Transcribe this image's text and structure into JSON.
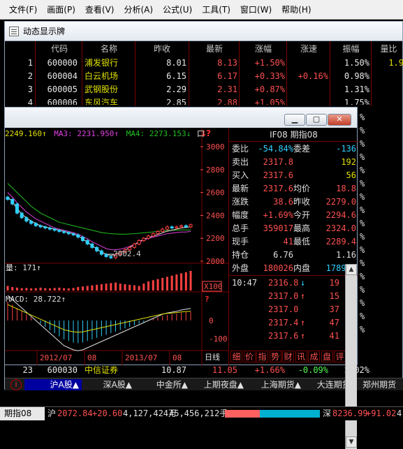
{
  "menu": [
    "文件(F)",
    "画面(P)",
    "查看(V)",
    "分析(A)",
    "公式(U)",
    "工具(T)",
    "窗口(W)",
    "帮助(H)"
  ],
  "subwindow_title": "动态显示牌",
  "table": {
    "headers": [
      "代码",
      "名称",
      "昨收",
      "最新",
      "涨幅",
      "涨速",
      "振幅",
      "量比"
    ],
    "rows": [
      {
        "idx": "1",
        "code": "600000",
        "name": "浦发银行",
        "prev": "8.01",
        "last": "8.13",
        "chg": "+1.50%",
        "speed": "",
        "amp": "1.50%",
        "vr": "1.9"
      },
      {
        "idx": "2",
        "code": "600004",
        "name": "白云机场",
        "prev": "6.15",
        "last": "6.17",
        "chg": "+0.33%",
        "speed": "+0.16%",
        "amp": "0.98%",
        "vr": ""
      },
      {
        "idx": "3",
        "code": "600005",
        "name": "武钢股份",
        "prev": "2.29",
        "last": "2.31",
        "chg": "+0.87%",
        "speed": "",
        "amp": "1.31%",
        "vr": ""
      },
      {
        "idx": "4",
        "code": "600006",
        "name": "东风汽车",
        "prev": "2.85",
        "last": "2.88",
        "chg": "+1.05%",
        "speed": "",
        "amp": "1.75%",
        "vr": ""
      }
    ],
    "row23": {
      "idx": "23",
      "code": "600030",
      "name": "中信证券",
      "prev": "10.87",
      "last": "11.05",
      "chg": "+1.66%",
      "speed": "-0.09%",
      "amp": "2.02%"
    },
    "partial_column": [
      "%",
      "%",
      "%",
      "%",
      "%",
      "%",
      "%",
      "%",
      "%",
      "%",
      "%",
      "%",
      "%",
      "%",
      "%",
      "%",
      "%"
    ]
  },
  "tabs": [
    {
      "label": "沪A股▲",
      "active": true
    },
    {
      "label": "深A股▲",
      "active": false
    },
    {
      "label": "中金所▲",
      "active": false
    },
    {
      "label": "上期夜盘▲",
      "active": false
    },
    {
      "label": "上海期货▲",
      "active": false
    },
    {
      "label": "大连期货▲",
      "active": false
    },
    {
      "label": "郑州期货",
      "active": false
    }
  ],
  "chart_window": {
    "title": "IF08 期指08",
    "legend": {
      "ma_prefix": "2249.160↑",
      "ma3": "MA3: 2231.950↑",
      "ma4": "MA4: 2273.153↓",
      "tail": "口"
    },
    "price_axis": [
      "3000",
      "2800",
      "2600",
      "2400",
      "2200",
      "2000"
    ],
    "low_label": "2002.4",
    "volume_label": "量: 171↑",
    "volume_unit": "X100",
    "macd_label": "MACD: 28.722↑",
    "macd_axis": [
      "0",
      "-100"
    ],
    "question_mark": "?",
    "date_labels": [
      "2012/07",
      "08",
      "2013/07",
      "08"
    ],
    "period": "日线",
    "icons_row": [
      "↓",
      "?"
    ]
  },
  "info_panel": {
    "rows": [
      {
        "l1": "委比",
        "v1": "-54.84%",
        "l2": "委差",
        "v2": "-136"
      },
      {
        "l1": "卖出",
        "v1": "2317.8",
        "l2": "",
        "v2": "192"
      },
      {
        "l1": "买入",
        "v1": "2317.6",
        "l2": "",
        "v2": "56"
      },
      {
        "l1": "最新",
        "v1": "2317.6",
        "l2": "均价",
        "v2": "18.8"
      },
      {
        "l1": "涨跌",
        "v1": "38.6",
        "l2": "昨收",
        "v2": "2279.0"
      },
      {
        "l1": "幅度",
        "v1": "+1.69%",
        "l2": "今开",
        "v2": "2294.6"
      },
      {
        "l1": "总手",
        "v1": "359017",
        "l2": "最高",
        "v2": "2324.0"
      },
      {
        "l1": "现手",
        "v1": "41",
        "l2": "最低",
        "v2": "2289.4"
      },
      {
        "l1": "持仓",
        "v1": "6.76",
        "l2": "",
        "v2": "1.16"
      },
      {
        "l1": "外盘",
        "v1": "180026",
        "l2": "内盘",
        "v2": "178991"
      }
    ],
    "ticks": [
      {
        "time": "10:47",
        "price": "2316.8",
        "arrow": "↓",
        "vol": "19"
      },
      {
        "time": "",
        "price": "2317.0",
        "arrow": "↑",
        "vol": "15"
      },
      {
        "time": "",
        "price": "2317.0",
        "arrow": "",
        "vol": "37"
      },
      {
        "time": "",
        "price": "2317.4",
        "arrow": "↑",
        "vol": "47"
      },
      {
        "time": "",
        "price": "2317.6",
        "arrow": "↑",
        "vol": "41"
      }
    ],
    "buttons": [
      "细",
      "价",
      "指",
      "势",
      "财",
      "讯",
      "成",
      "盘",
      "评"
    ]
  },
  "status": {
    "tab": "期指08",
    "sh_label": "沪",
    "sh_index": "2072.84",
    "sh_chg": "+20.60",
    "sh_vol": "4,127,424万",
    "sh_hands": "45,456,212手",
    "sz_label": "深",
    "sz_index": "8236.99",
    "sz_chg": "+91.02",
    "sz_tail": "4,"
  },
  "chart_data": {
    "type": "candlestick",
    "title": "IF08 期指08",
    "ylim": [
      2000,
      3050
    ],
    "y_ticks": [
      2000,
      2200,
      2400,
      2600,
      2800,
      3000
    ],
    "x_labels": [
      "2012/07",
      "08",
      "2013/07",
      "08"
    ],
    "price_approx": [
      2540,
      2500,
      2420,
      2380,
      2350,
      2330,
      2310,
      2300,
      2290,
      2280,
      2270,
      2260,
      2250,
      2240,
      2230,
      2210,
      2180,
      2150,
      2120,
      2090,
      2060,
      2040,
      2030,
      2060,
      2080,
      2100,
      2120,
      2150,
      2180,
      2200,
      2220,
      2240,
      2260,
      2280,
      2300,
      2290,
      2300,
      2310,
      2300,
      2318
    ],
    "ma_long_approx": [
      2680,
      2640,
      2600,
      2560,
      2520,
      2480,
      2450,
      2420,
      2400,
      2380,
      2360,
      2340,
      2330,
      2320,
      2310,
      2300,
      2290,
      2280,
      2270,
      2260,
      2250,
      2245,
      2240,
      2238,
      2236,
      2236,
      2238,
      2240,
      2244,
      2248,
      2252,
      2256,
      2260,
      2265,
      2268,
      2270,
      2272,
      2273,
      2273,
      2273
    ],
    "ma_mid_approx": [
      2600,
      2560,
      2510,
      2470,
      2430,
      2400,
      2370,
      2350,
      2330,
      2310,
      2290,
      2280,
      2270,
      2260,
      2250,
      2235,
      2215,
      2195,
      2170,
      2150,
      2130,
      2110,
      2100,
      2100,
      2105,
      2115,
      2130,
      2145,
      2165,
      2185,
      2200,
      2210,
      2220,
      2230,
      2240,
      2245,
      2250,
      2255,
      2255,
      2260
    ],
    "ma_short_approx": [
      2560,
      2520,
      2460,
      2410,
      2380,
      2350,
      2330,
      2310,
      2300,
      2290,
      2280,
      2270,
      2260,
      2250,
      2240,
      2220,
      2195,
      2165,
      2135,
      2105,
      2080,
      2060,
      2050,
      2060,
      2075,
      2095,
      2120,
      2145,
      2170,
      2190,
      2205,
      2220,
      2232,
      2248,
      2262,
      2270,
      2280,
      2290,
      2295,
      2300
    ],
    "low_point": 2002.4,
    "volume_approx": [
      40,
      30,
      25,
      20,
      22,
      18,
      20,
      25,
      20,
      18,
      22,
      25,
      20,
      18,
      22,
      30,
      35,
      40,
      45,
      50,
      55,
      60,
      65,
      70,
      60,
      55,
      50,
      45,
      40,
      60,
      80,
      90,
      100,
      110,
      120,
      130,
      140,
      150,
      160,
      171
    ],
    "macd_approx": [
      60,
      50,
      40,
      30,
      20,
      10,
      0,
      -10,
      -20,
      -30,
      -40,
      -50,
      -60,
      -65,
      -70,
      -72,
      -70,
      -65,
      -60,
      -55,
      -50,
      -45,
      -40,
      -35,
      -30,
      -25,
      -20,
      -15,
      -10,
      -5,
      0,
      5,
      10,
      15,
      18,
      20,
      22,
      25,
      27,
      28.7
    ]
  }
}
